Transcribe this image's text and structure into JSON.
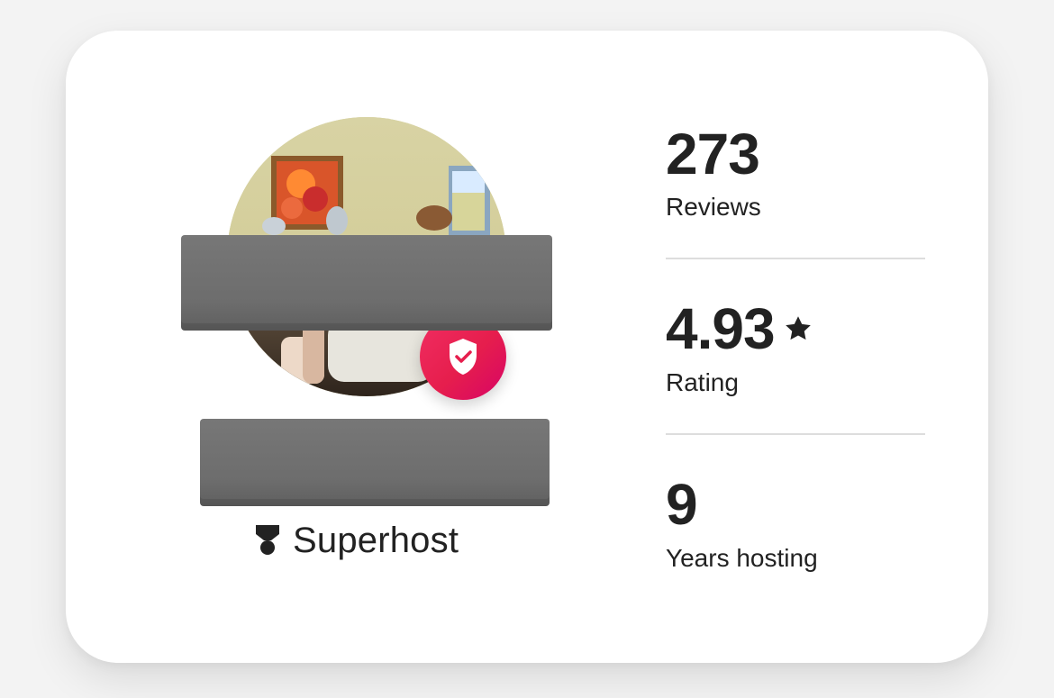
{
  "host_card": {
    "badge_label": "Superhost",
    "icons": {
      "superhost_icon": "medal-icon",
      "verified_icon": "shield-check-icon",
      "rating_icon": "star-icon"
    },
    "colors": {
      "accent": "#E61E4D",
      "text": "#222222",
      "divider": "#DDDDDD",
      "redaction": "#6D6D6D"
    }
  },
  "stats": {
    "reviews": {
      "value": "273",
      "label": "Reviews"
    },
    "rating": {
      "value": "4.93",
      "label": "Rating"
    },
    "years": {
      "value": "9",
      "label": "Years hosting"
    }
  }
}
